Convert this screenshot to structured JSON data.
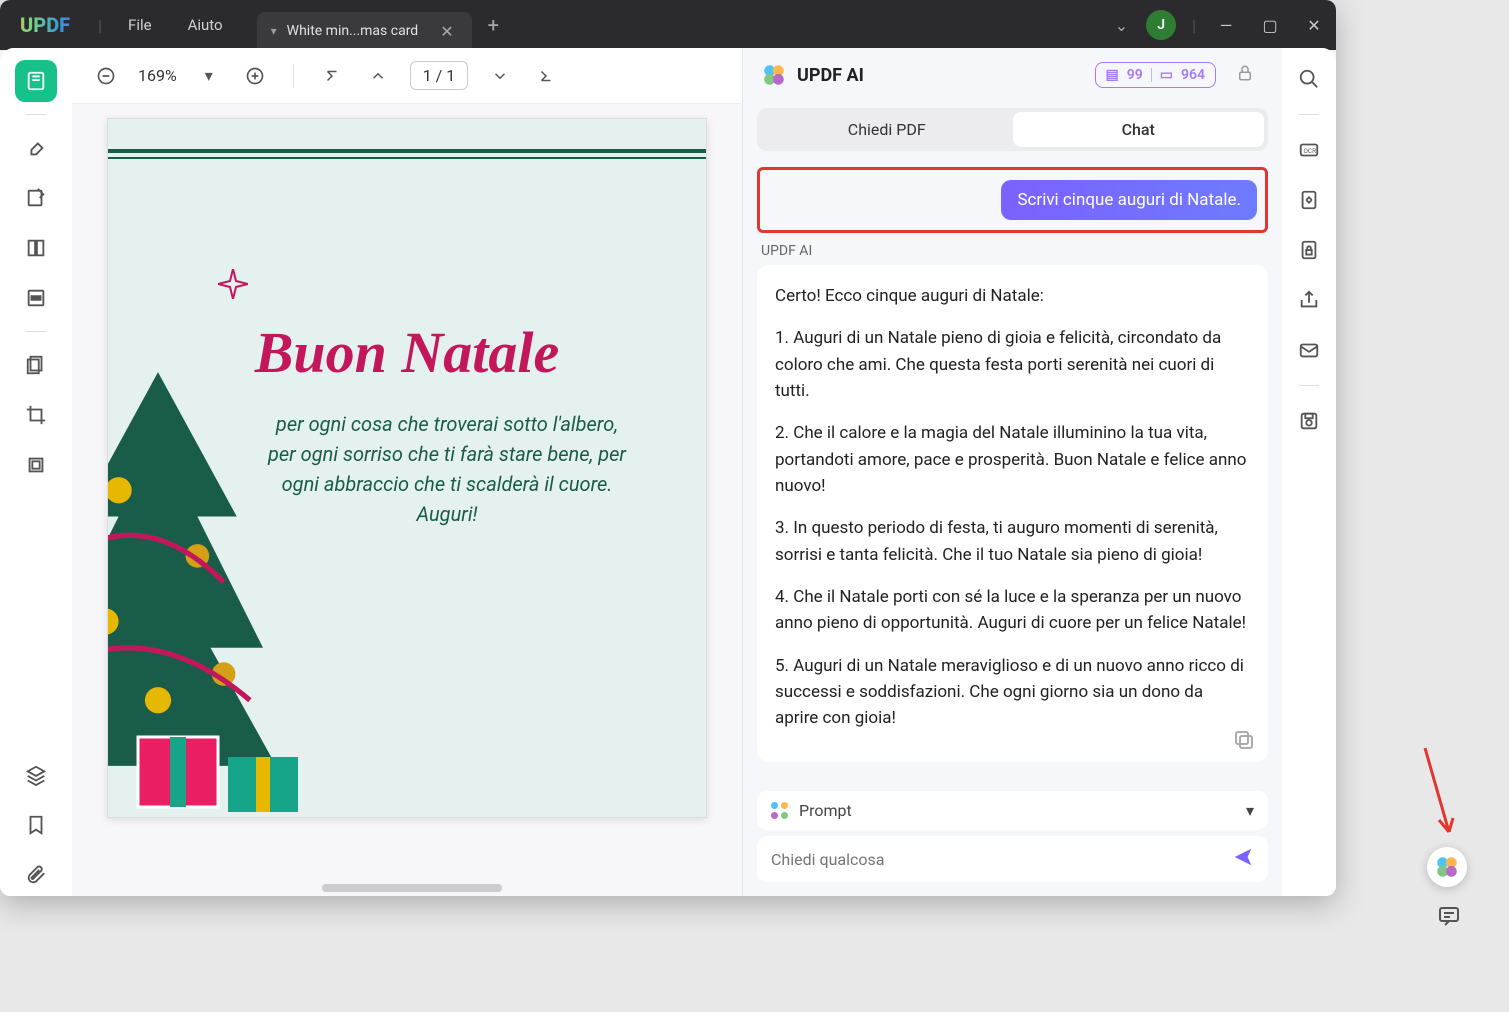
{
  "titlebar": {
    "logo": "UPDF",
    "menu_file": "File",
    "menu_help": "Aiuto",
    "tab_label": "White min...mas card",
    "avatar_letter": "J"
  },
  "toolbar": {
    "zoom": "169%",
    "page_current": "1",
    "page_sep": "/",
    "page_total": "1"
  },
  "document": {
    "title": "Buon Natale",
    "body_line1": "per ogni cosa che troverai sotto l'albero,",
    "body_line2": "per ogni sorriso che ti farà stare bene, per",
    "body_line3": "ogni abbraccio che ti scalderà il cuore.",
    "body_line4": "Auguri!"
  },
  "ai": {
    "title": "UPDF AI",
    "badge1_count": "99",
    "badge2_count": "964",
    "tab_pdf": "Chiedi PDF",
    "tab_chat": "Chat",
    "user_message": "Scrivi cinque auguri di Natale.",
    "response_label": "UPDF AI",
    "response_intro": "Certo! Ecco cinque auguri di Natale:",
    "response_1": "1. Auguri di un Natale pieno di gioia e felicità, circondato da coloro che ami. Che questa festa porti serenità nei cuori di tutti.",
    "response_2": "2. Che il calore e la magia del Natale illuminino la tua vita, portandoti amore, pace e prosperità. Buon Natale e felice anno nuovo!",
    "response_3": "3. In questo periodo di festa, ti auguro momenti di serenità, sorrisi e tanta felicità. Che il tuo Natale sia pieno di gioia!",
    "response_4": "4. Che il Natale porti con sé la luce e la speranza per un nuovo anno pieno di opportunità. Auguri di cuore per un felice Natale!",
    "response_5": "5. Auguri di un Natale meraviglioso e di un nuovo anno ricco di successi e soddisfazioni. Che ogni giorno sia un dono da aprire con gioia!",
    "prompt_label": "Prompt",
    "input_placeholder": "Chiedi qualcosa"
  }
}
